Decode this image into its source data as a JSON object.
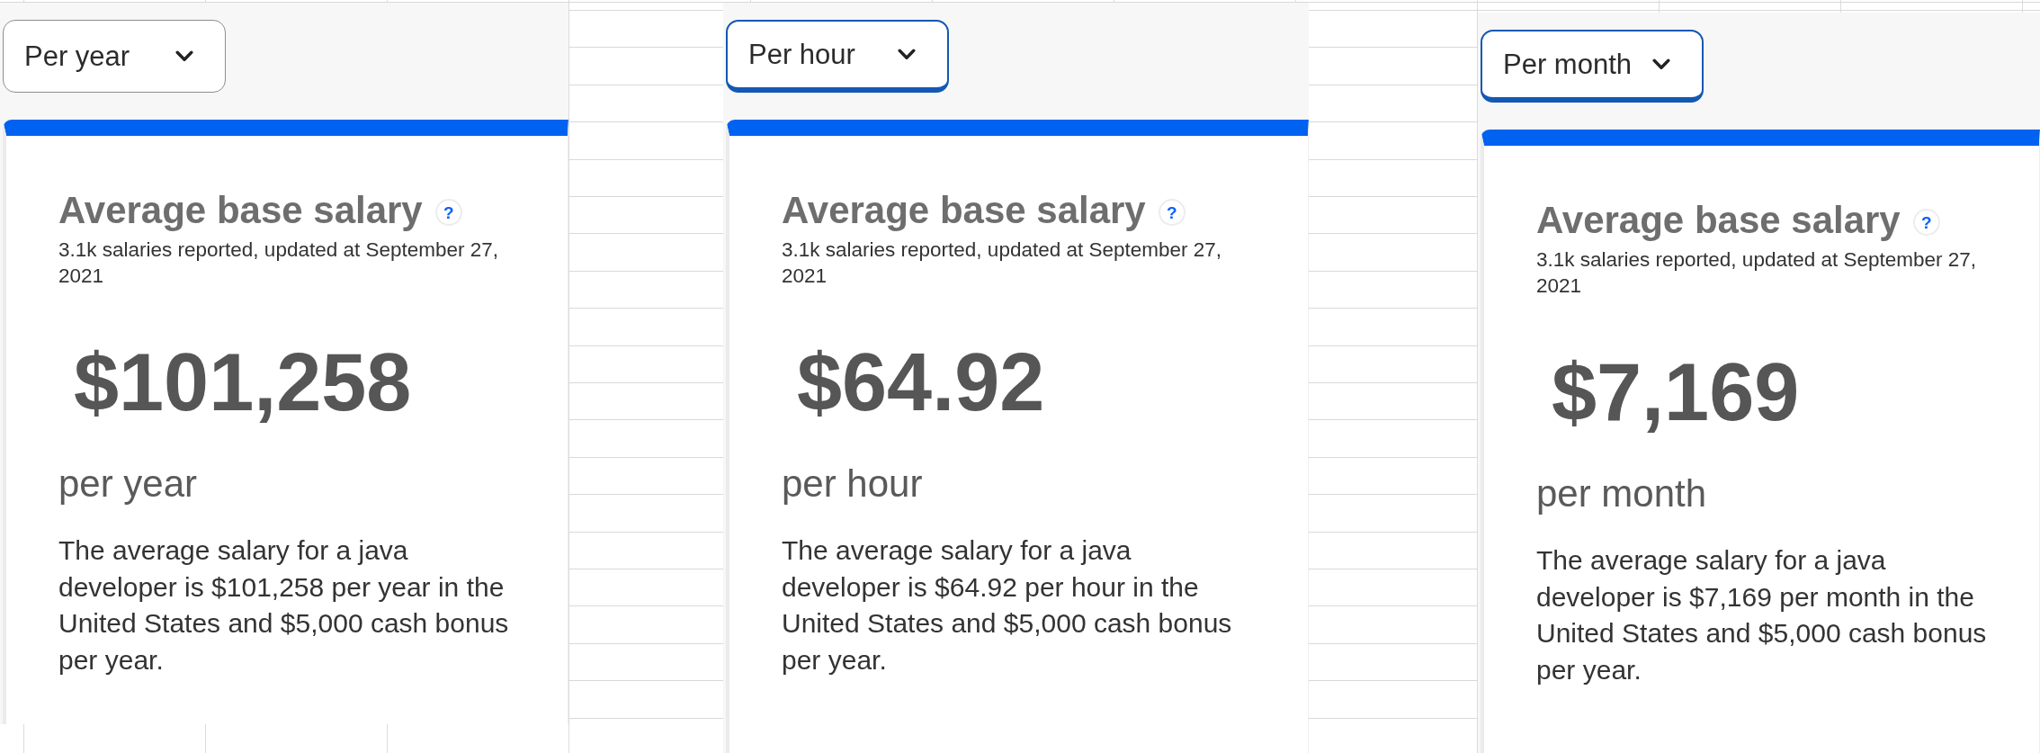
{
  "panels": [
    {
      "dropdown": {
        "value": "Per year",
        "focused": false
      },
      "card": {
        "title": "Average base salary",
        "help": "?",
        "subtitle": "3.1k salaries reported, updated at September 27, 2021",
        "amount": "$101,258",
        "period": "per year",
        "description": "The average salary for a java developer is $101,258 per year in the United States and $5,000 cash bonus per year."
      }
    },
    {
      "dropdown": {
        "value": "Per hour",
        "focused": true
      },
      "card": {
        "title": "Average base salary",
        "help": "?",
        "subtitle": "3.1k salaries reported, updated at September 27, 2021",
        "amount": "$64.92",
        "period": "per hour",
        "description": "The average salary for a java developer is $64.92 per hour in the United States and $5,000 cash bonus per year."
      }
    },
    {
      "dropdown": {
        "value": "Per month",
        "focused": true
      },
      "card": {
        "title": "Average base salary",
        "help": "?",
        "subtitle": "3.1k salaries reported, updated at September 27, 2021",
        "amount": "$7,169",
        "period": "per month",
        "description": "The average salary for a java developer is $7,169 per month in the United States and $5,000 cash bonus per year."
      }
    }
  ]
}
